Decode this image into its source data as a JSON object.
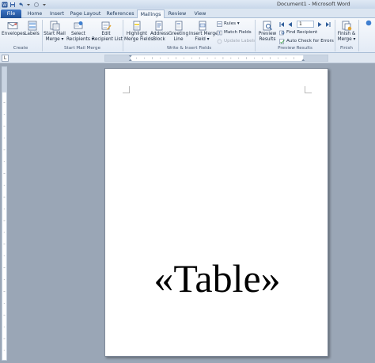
{
  "window": {
    "title": "Document1 - Microsoft Word"
  },
  "tabs": {
    "file": "File",
    "home": "Home",
    "insert": "Insert",
    "page_layout": "Page Layout",
    "references": "References",
    "mailings": "Mailings",
    "review": "Review",
    "view": "View",
    "active": "Mailings"
  },
  "ribbon": {
    "groups": {
      "create": "Create",
      "start_mail_merge": "Start Mail Merge",
      "write_insert_fields": "Write & Insert Fields",
      "preview_results": "Preview Results",
      "finish": "Finish"
    },
    "create": {
      "envelopes": "Envelopes",
      "labels": "Labels"
    },
    "start_mail_merge": {
      "start_line1": "Start Mail",
      "start_line2": "Merge ▾",
      "select_line1": "Select",
      "select_line2": "Recipients ▾",
      "edit_line1": "Edit",
      "edit_line2": "Recipient List"
    },
    "write_insert_fields": {
      "highlight_line1": "Highlight",
      "highlight_line2": "Merge Fields",
      "address_line1": "Address",
      "address_line2": "Block",
      "greeting_line1": "Greeting",
      "greeting_line2": "Line",
      "insert_line1": "Insert Merge",
      "insert_line2": "Field ▾",
      "rules": "Rules ▾",
      "match_fields": "Match Fields",
      "update_labels": "Update Labels"
    },
    "preview_results": {
      "preview_line1": "Preview",
      "preview_line2": "Results",
      "record_value": "1",
      "find_recipient": "Find Recipient",
      "auto_check": "Auto Check for Errors"
    },
    "finish": {
      "finish_line1": "Finish &",
      "finish_line2": "Merge ▾"
    }
  },
  "ruler": {
    "tab_selector": "L"
  },
  "document": {
    "merge_field": "«Table»"
  },
  "colors": {
    "file_tab": "#2b579a",
    "workspace": "#9aa6b6"
  }
}
